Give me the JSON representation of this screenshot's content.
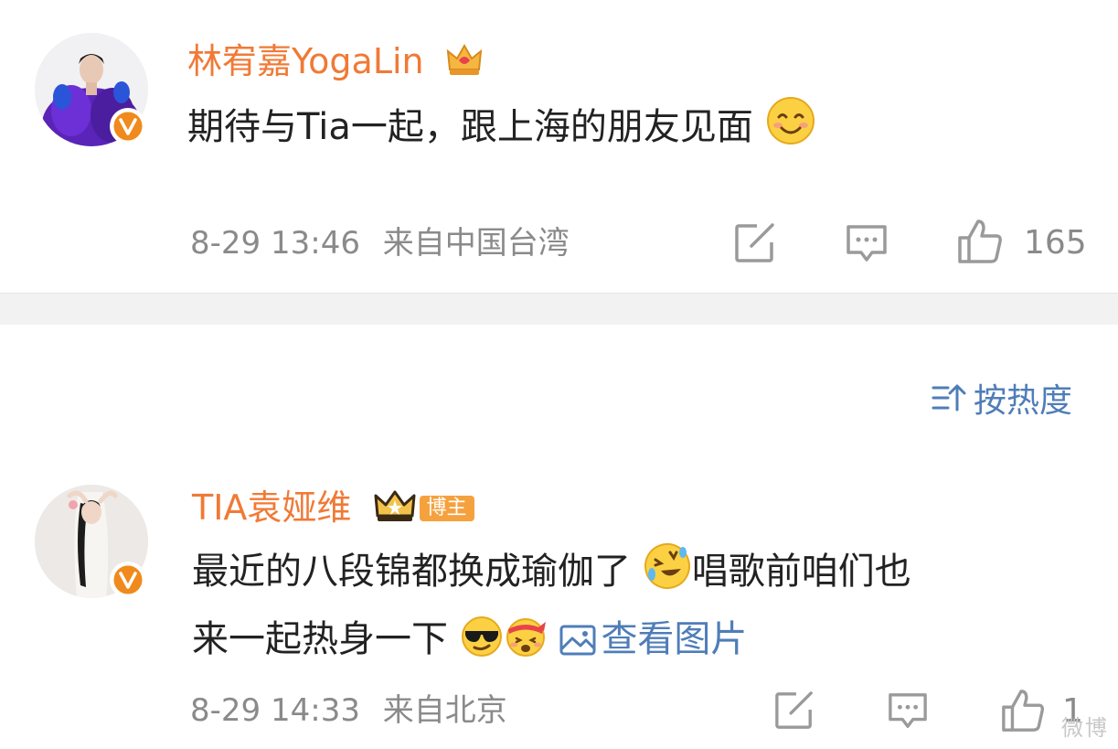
{
  "comments": [
    {
      "username": "林宥嘉YogaLin",
      "text_line1": "期待与Tia一起，跟上海的朋友见面",
      "time": "8-29 13:46",
      "location": "来自中国台湾",
      "likes": "165"
    },
    {
      "username": "TIA袁娅维",
      "badge": "博主",
      "text_line1": "最近的八段锦都换成瑜伽了",
      "text_line1b": "唱歌前咱们也",
      "text_line2": "来一起热身一下",
      "image_link": "查看图片",
      "time": "8-29 14:33",
      "location": "来自北京",
      "likes": "1"
    }
  ],
  "sort": {
    "label": "按热度"
  },
  "watermark": "微博"
}
